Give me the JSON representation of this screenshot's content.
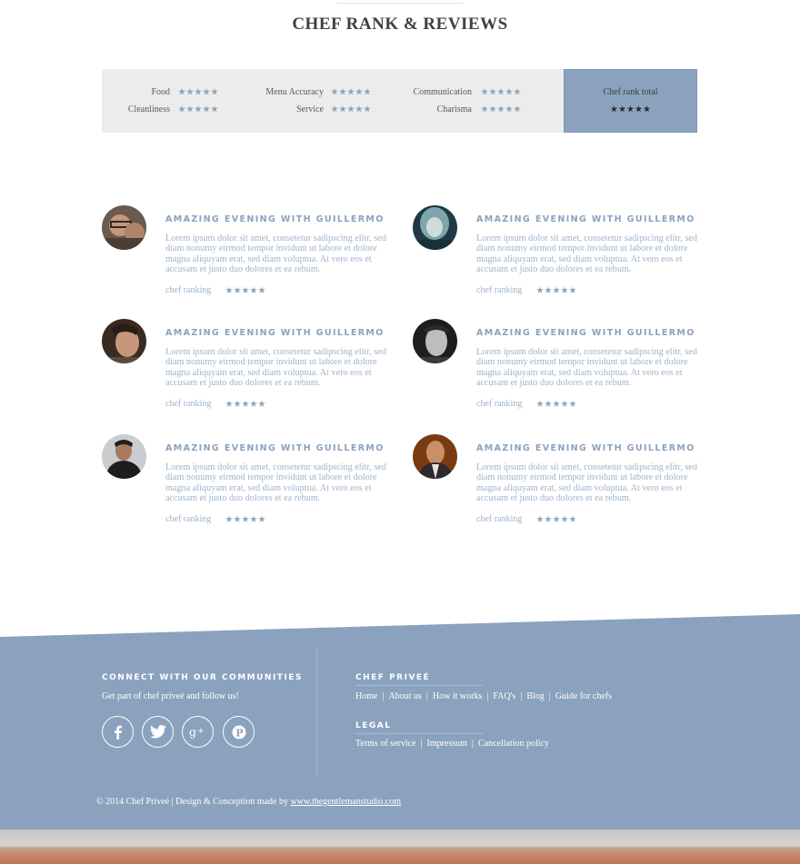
{
  "section": {
    "title": "CHEF RANK & REVIEWS"
  },
  "rank_panel": {
    "items": [
      {
        "label": "Food",
        "stars": 5
      },
      {
        "label": "Menu Accuracy",
        "stars": 5
      },
      {
        "label": "Communication",
        "stars": 5
      },
      {
        "label": "Cleanliness",
        "stars": 5
      },
      {
        "label": "Service",
        "stars": 5
      },
      {
        "label": "Charisma",
        "stars": 5
      }
    ],
    "total_label": "Chef rank total",
    "total_stars": 5
  },
  "reviews": [
    {
      "title": "AMAZING EVENING WITH GUILLERMO",
      "body": "Lorem ipsum dolor sit amet, consetetur sadipscing elitr, sed diam nonumy eirmod tempor invidunt ut labore et dolore magna aliquyam erat, sed diam voluptua. At vero eos et accusam et justo duo dolores et ea rebum.",
      "rank_label": "chef ranking",
      "stars": 5
    },
    {
      "title": "AMAZING EVENING WITH GUILLERMO",
      "body": "Lorem ipsum dolor sit amet, consetetur sadipscing elitr, sed diam nonumy eirmod tempor invidunt ut labore et dolore magna aliquyam erat, sed diam voluptua. At vero eos et accusam et justo duo dolores et ea rebum.",
      "rank_label": "chef ranking",
      "stars": 5
    },
    {
      "title": "AMAZING EVENING WITH GUILLERMO",
      "body": "Lorem ipsum dolor sit amet, consetetur sadipscing elitr, sed diam nonumy eirmod tempor invidunt ut labore et dolore magna aliquyam erat, sed diam voluptua. At vero eos et accusam et justo duo dolores et ea rebum.",
      "rank_label": "chef ranking",
      "stars": 5
    },
    {
      "title": "AMAZING EVENING WITH GUILLERMO",
      "body": "Lorem ipsum dolor sit amet, consetetur sadipscing elitr, sed diam nonumy eirmod tempor invidunt ut labore et dolore magna aliquyam erat, sed diam voluptua. At vero eos et accusam et justo duo dolores et ea rebum.",
      "rank_label": "chef ranking",
      "stars": 5
    },
    {
      "title": "AMAZING EVENING WITH GUILLERMO",
      "body": "Lorem ipsum dolor sit amet, consetetur sadipscing elitr, sed diam nonumy eirmod tempor invidunt ut labore et dolore magna aliquyam erat, sed diam voluptua. At vero eos et accusam et justo duo dolores et ea rebum.",
      "rank_label": "chef ranking",
      "stars": 5
    },
    {
      "title": "AMAZING EVENING WITH GUILLERMO",
      "body": "Lorem ipsum dolor sit amet, consetetur sadipscing elitr, sed diam nonumy eirmod tempor invidunt ut labore et dolore magna aliquyam erat, sed diam voluptua. At vero eos et accusam et justo duo dolores et ea rebum.",
      "rank_label": "chef ranking",
      "stars": 5
    }
  ],
  "footer": {
    "connect_heading": "CONNECT WITH OUR COMMUNITIES",
    "connect_text": "Get part of chef priveé and follow us!",
    "social_icons": [
      "facebook-icon",
      "twitter-icon",
      "google-plus-icon",
      "pinterest-icon"
    ],
    "brand_heading": "CHEF PRIVEÉ",
    "brand_links": [
      "Home",
      "About us",
      "How it works",
      "FAQ's",
      "Blog",
      "Guide for chefs"
    ],
    "legal_heading": "LEGAL",
    "legal_links": [
      "Terms of service",
      "Impressum",
      "Cancellation policy"
    ],
    "copyright_text": "© 2014 Chef Priveé  |  Design & Conception made by",
    "copyright_link": "www.thegentlemanstudio.com"
  },
  "colors": {
    "accent": "#8aa2bd",
    "panel": "#ececec",
    "title": "#3d4045"
  }
}
